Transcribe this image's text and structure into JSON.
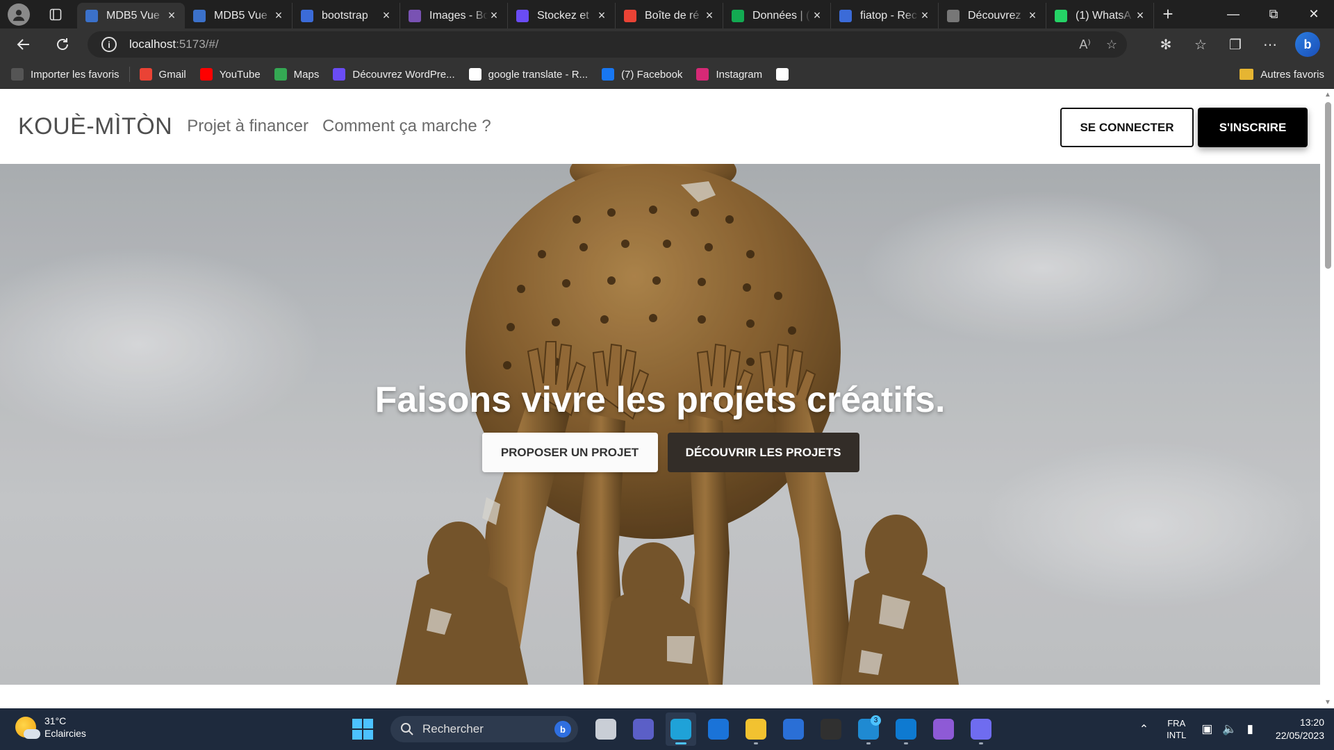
{
  "browser": {
    "tabs": [
      {
        "title": "MDB5 Vue",
        "favicon": "mdb-icon",
        "color": "#3b71ca",
        "active": true
      },
      {
        "title": "MDB5 Vue",
        "favicon": "mdb-icon",
        "color": "#3b71ca",
        "active": false
      },
      {
        "title": "bootstrap",
        "favicon": "search-icon",
        "color": "#3b6bd8",
        "active": false
      },
      {
        "title": "Images - Bo",
        "favicon": "bootstrap-icon",
        "color": "#7952b3",
        "active": false
      },
      {
        "title": "Stockez et",
        "favicon": "dropbox-icon",
        "color": "#6a4cf5",
        "active": false
      },
      {
        "title": "Boîte de ré",
        "favicon": "gmail-icon",
        "color": "#ea4335",
        "active": false
      },
      {
        "title": "Données | (",
        "favicon": "mongodb-icon",
        "color": "#13aa52",
        "active": false
      },
      {
        "title": "fiatop - Rec",
        "favicon": "search-icon",
        "color": "#3b6bd8",
        "active": false
      },
      {
        "title": "Découvrez",
        "favicon": "page-icon",
        "color": "#777777",
        "active": false
      },
      {
        "title": "(1) WhatsA",
        "favicon": "whatsapp-icon",
        "color": "#25d366",
        "active": false
      }
    ],
    "address": {
      "host": "localhost",
      "rest": ":5173/#/"
    },
    "read_aloud": "A⁾",
    "bookmarks": [
      {
        "label": "Importer les favoris",
        "icon": "import-icon",
        "color": "#555555"
      },
      {
        "label": "Gmail",
        "icon": "gmail-icon",
        "color": "#ea4335"
      },
      {
        "label": "YouTube",
        "icon": "youtube-icon",
        "color": "#ff0000"
      },
      {
        "label": "Maps",
        "icon": "maps-icon",
        "color": "#34a853"
      },
      {
        "label": "Découvrez WordPre...",
        "icon": "dropbox-icon",
        "color": "#6a4cf5"
      },
      {
        "label": "google translate - R...",
        "icon": "google-icon",
        "color": "#ffffff"
      },
      {
        "label": "(7) Facebook",
        "icon": "facebook-icon",
        "color": "#1877f2"
      },
      {
        "label": "Instagram",
        "icon": "instagram-icon",
        "color": "#d62976"
      },
      {
        "label": "",
        "icon": "github-icon",
        "color": "#ffffff"
      }
    ],
    "other_favorites": "Autres favoris"
  },
  "site": {
    "brand": "KOUÈ-MÌTÒN",
    "nav": [
      "Projet à financer",
      "Comment ça marche ?"
    ],
    "login": "SE CONNECTER",
    "signup": "S'INSCRIRE",
    "hero": {
      "title": "Faisons vivre les projets créatifs.",
      "primary": "PROPOSER UN PROJET",
      "secondary": "DÉCOUVRIR LES PROJETS"
    }
  },
  "taskbar": {
    "temperature": "31°C",
    "weather": "Eclaircies",
    "search": "Rechercher",
    "apps": [
      {
        "name": "task-view-icon",
        "color": "#c9ced6",
        "active": false,
        "running": false,
        "badge": ""
      },
      {
        "name": "meet-icon",
        "color": "#5b5fc7",
        "active": false,
        "running": false,
        "badge": ""
      },
      {
        "name": "edge-icon",
        "color": "#1fa2d8",
        "active": true,
        "running": true,
        "badge": ""
      },
      {
        "name": "mail-icon",
        "color": "#1a73d8",
        "active": false,
        "running": false,
        "badge": ""
      },
      {
        "name": "file-explorer-icon",
        "color": "#f2c230",
        "active": false,
        "running": true,
        "badge": ""
      },
      {
        "name": "store-icon",
        "color": "#2a6fd6",
        "active": false,
        "running": false,
        "badge": ""
      },
      {
        "name": "terminal-icon",
        "color": "#303030",
        "active": false,
        "running": false,
        "badge": ""
      },
      {
        "name": "vscode-blue-icon",
        "color": "#1f8ad2",
        "active": false,
        "running": true,
        "badge": "3"
      },
      {
        "name": "vscode-icon",
        "color": "#0e7ad1",
        "active": false,
        "running": true,
        "badge": ""
      },
      {
        "name": "visual-studio-icon",
        "color": "#8e5ad6",
        "active": false,
        "running": false,
        "badge": ""
      },
      {
        "name": "app-icon",
        "color": "#6f6cf0",
        "active": false,
        "running": true,
        "badge": ""
      }
    ],
    "lang1": "FRA",
    "lang2": "INTL",
    "time": "13:20",
    "date": "22/05/2023"
  }
}
